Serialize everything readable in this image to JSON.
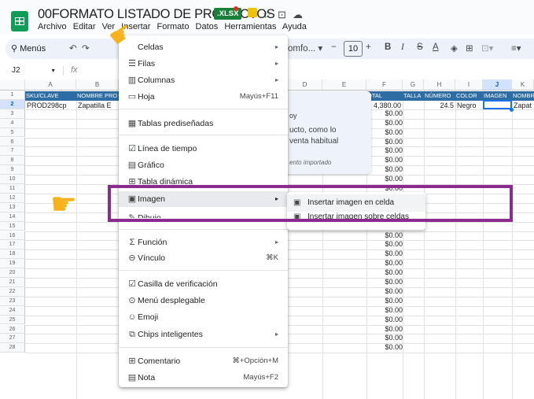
{
  "header": {
    "title": "00FORMATO LISTADO DE PRODUCTOS",
    "badge": ".XLSX",
    "menus": [
      "Archivo",
      "Editar",
      "Ver",
      "Insertar",
      "Formato",
      "Datos",
      "Herramientas",
      "Ayuda"
    ]
  },
  "toolbar": {
    "search": "Menús",
    "font": "omfo...",
    "font_size": "10",
    "bold": "B",
    "italic": "I"
  },
  "formula_bar": {
    "cell_ref": "J2",
    "fx": "fx"
  },
  "grid": {
    "columns": [
      "A",
      "B",
      "C",
      "D",
      "E",
      "F",
      "G",
      "H",
      "I",
      "J",
      "K"
    ],
    "rows": [
      "1",
      "2",
      "3",
      "4",
      "5",
      "6",
      "7",
      "8",
      "9",
      "10",
      "11",
      "12",
      "13",
      "14",
      "15",
      "16",
      "17",
      "18",
      "19",
      "20",
      "21",
      "22",
      "23",
      "24",
      "25",
      "26",
      "27",
      "28"
    ],
    "headers": {
      "sku": "SKU/CLAVE",
      "nombre": "NOMBRE PRO",
      "total": "OTAL",
      "talla": "TALLA",
      "numero": "NÚMERO",
      "color": "COLOR",
      "imagen": "IMAGEN",
      "nombre2": "NOMBR"
    },
    "row2": {
      "sku": "PROD298cp",
      "nombre": "Zapatilla E",
      "total": "4,380.00",
      "numero": "24.5",
      "color": "Negro",
      "nombre2": "Zapat"
    },
    "dollar": "$0.00"
  },
  "menu": {
    "items": [
      {
        "icon": "",
        "label": "Celdas",
        "arrow": "▸"
      },
      {
        "icon": "☰",
        "label": "Filas",
        "arrow": "▸"
      },
      {
        "icon": "▥",
        "label": "Columnas",
        "arrow": "▸"
      },
      {
        "icon": "▭",
        "label": "Hoja",
        "shortcut": "Mayús+F11"
      },
      {
        "icon": "▦",
        "label": "Tablas prediseñadas"
      },
      {
        "icon": "☑",
        "label": "Línea de tiempo"
      },
      {
        "icon": "▤",
        "label": "Gráfico"
      },
      {
        "icon": "⊞",
        "label": "Tabla dinámica"
      },
      {
        "icon": "▣",
        "label": "Imagen",
        "arrow": "▸"
      },
      {
        "icon": "✎",
        "label": "Dibujo"
      },
      {
        "icon": "Σ",
        "label": "Función",
        "arrow": "▸"
      },
      {
        "icon": "⊖",
        "label": "Vínculo",
        "shortcut": "⌘K"
      },
      {
        "icon": "☑",
        "label": "Casilla de verificación"
      },
      {
        "icon": "⊙",
        "label": "Menú desplegable"
      },
      {
        "icon": "☺",
        "label": "Emoji"
      },
      {
        "icon": "⧉",
        "label": "Chips inteligentes",
        "arrow": "▸"
      },
      {
        "icon": "⊞",
        "label": "Comentario",
        "shortcut": "⌘+Opción+M"
      },
      {
        "icon": "▤",
        "label": "Nota",
        "shortcut": "Mayús+F2"
      }
    ]
  },
  "card": {
    "line1": "oy",
    "line2": "ucto, como lo",
    "line3": "venta habitual",
    "footer": "ento importado"
  },
  "submenu": {
    "items": [
      "Insertar imagen en celda",
      "Insertar imagen sobre celdas"
    ]
  },
  "colors": {
    "accent_purple": "#8b2a8f",
    "header_blue": "#2e6da4",
    "sheets_green": "#0f9d58"
  }
}
